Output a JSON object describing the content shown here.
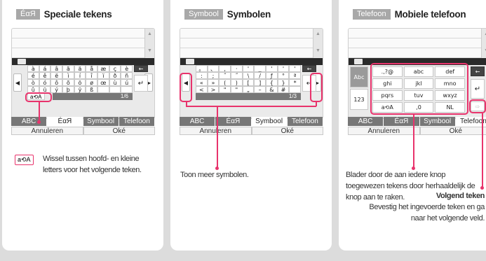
{
  "panel1": {
    "mode_tag": "ÉαЯ",
    "title": "Speciale tekens",
    "rows": [
      [
        "à",
        "á",
        "â",
        "ã",
        "ä",
        "å",
        "æ",
        "ç",
        "è"
      ],
      [
        "é",
        "ê",
        "ë",
        "ì",
        "í",
        "î",
        "ï",
        "ð",
        "ñ"
      ],
      [
        "ò",
        "ó",
        "ô",
        "õ",
        "ö",
        "ø",
        "œ",
        "ù",
        "ú"
      ],
      [
        "û",
        "ü",
        "ý",
        "þ",
        "ÿ",
        "ß",
        "",
        "",
        ""
      ]
    ],
    "backspace": "←",
    "enter": "↵",
    "left": "◀",
    "right": "▶",
    "case_key": "a⟲A",
    "page": "1/6",
    "tabs": [
      "ABC",
      "ÉαЯ",
      "Symbool",
      "Telefoon"
    ],
    "cancel": "Annuleren",
    "ok": "Oké",
    "badge": "a⟲A",
    "caption": "Wissel tussen hoofd- en kleine letters voor het volgende teken."
  },
  "panel2": {
    "mode_tag": "Symbool",
    "title": "Symbolen",
    "rows": [
      [
        "。",
        "、",
        ",",
        "·",
        "'",
        "_",
        "'",
        "'",
        "'"
      ],
      [
        ":",
        ";",
        "˝",
        "˝",
        "\\",
        "/",
        "ƒ",
        "°",
        "ª"
      ],
      [
        "«",
        "»",
        "(",
        ")",
        "[",
        "]",
        "{",
        "}",
        "*"
      ],
      [
        "<",
        ">",
        "\"",
        "\"",
        "„",
        "–",
        "&",
        "#",
        ""
      ]
    ],
    "backspace": "←",
    "enter": "↵",
    "left": "◀",
    "right": "▶",
    "page": "1/3",
    "tabs": [
      "ABC",
      "ÉαЯ",
      "Symbool",
      "Telefoon"
    ],
    "cancel": "Annuleren",
    "ok": "Oké",
    "caption": "Toon meer symbolen."
  },
  "panel3": {
    "mode_tag": "Telefoon",
    "title": "Mobiele telefoon",
    "side_top": "Abc",
    "side_bottom": "123",
    "keys": [
      [
        ".,?@",
        "abc",
        "def"
      ],
      [
        "ghi",
        "jkl",
        "mno"
      ],
      [
        "pqrs",
        "tuv",
        "wxyz"
      ],
      [
        "a⟲A",
        ",0",
        "NL"
      ]
    ],
    "backspace": "←",
    "enter": "↵",
    "next": "⇨",
    "tabs": [
      "ABC",
      "ÉαЯ",
      "Symbool",
      "Telefoon"
    ],
    "cancel": "Annuleren",
    "ok": "Oké",
    "caption": "Blader door de aan iedere knop toegewezen tekens door herhaaldelijk de knop aan te raken.",
    "next_title": "Volgend teken",
    "next_caption": "Bevestig het ingevoerde teken en ga naar het volgende veld."
  },
  "colors": {
    "accent": "#e8336c",
    "tag": "#a8a8a8"
  }
}
